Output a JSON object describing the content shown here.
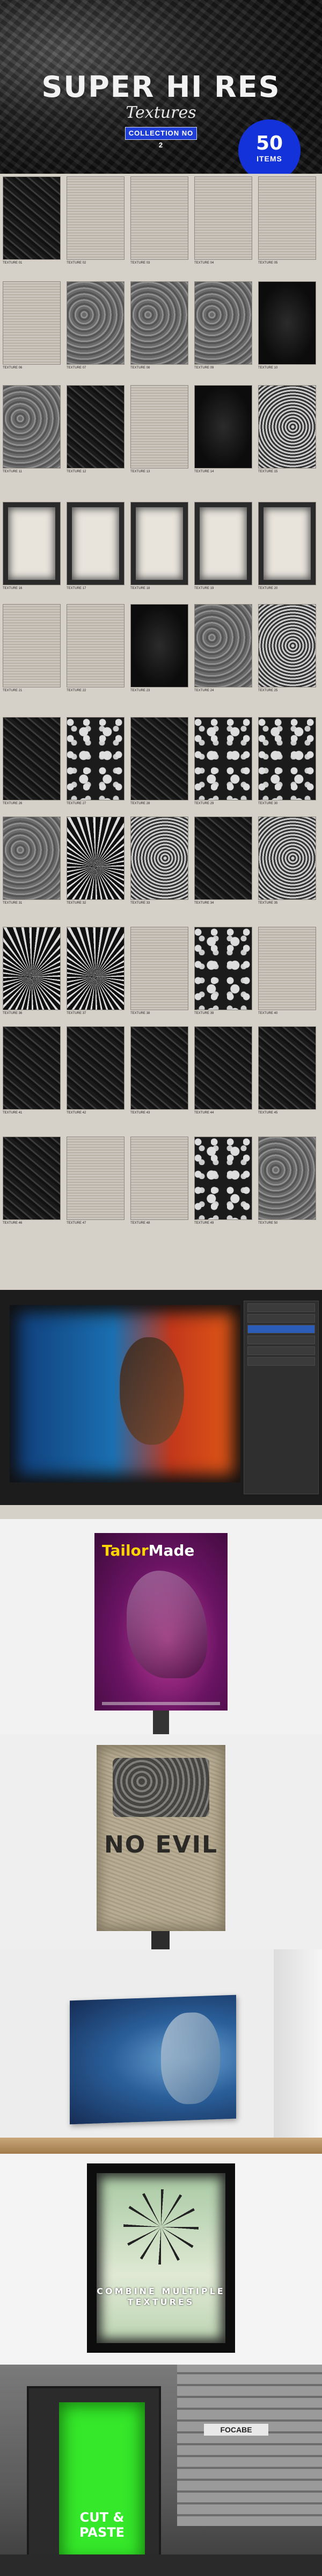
{
  "hero": {
    "title": "SUPER HI RES",
    "subtitle": "Textures",
    "collection": "COLLECTION NO 2",
    "badge_number": "50",
    "badge_label": "ITEMS"
  },
  "grid": {
    "rows": [
      [
        "TEXTURE 01",
        "TEXTURE 02",
        "TEXTURE 03",
        "TEXTURE 04",
        "TEXTURE 05"
      ],
      [
        "TEXTURE 06",
        "TEXTURE 07",
        "TEXTURE 08",
        "TEXTURE 09",
        "TEXTURE 10"
      ],
      [
        "TEXTURE 11",
        "TEXTURE 12",
        "TEXTURE 13",
        "TEXTURE 14",
        "TEXTURE 15"
      ],
      [
        "TEXTURE 16",
        "TEXTURE 17",
        "TEXTURE 18",
        "TEXTURE 19",
        "TEXTURE 20"
      ],
      [
        "TEXTURE 21",
        "TEXTURE 22",
        "TEXTURE 23",
        "TEXTURE 24",
        "TEXTURE 25"
      ],
      [
        "TEXTURE 26",
        "TEXTURE 27",
        "TEXTURE 28",
        "TEXTURE 29",
        "TEXTURE 30"
      ],
      [
        "TEXTURE 31",
        "TEXTURE 32",
        "TEXTURE 33",
        "TEXTURE 34",
        "TEXTURE 35"
      ],
      [
        "TEXTURE 36",
        "TEXTURE 37",
        "TEXTURE 38",
        "TEXTURE 39",
        "TEXTURE 40"
      ],
      [
        "TEXTURE 41",
        "TEXTURE 42",
        "TEXTURE 43",
        "TEXTURE 44",
        "TEXTURE 45"
      ],
      [
        "TEXTURE 46",
        "TEXTURE 47",
        "TEXTURE 48",
        "TEXTURE 49",
        "TEXTURE 50"
      ]
    ]
  },
  "showcase": {
    "tailor_brand_a": "Tailor",
    "tailor_brand_b": "Made",
    "no_evil": "NO EVIL",
    "combine_text": "COMBINE MULTIPLE TEXTURES",
    "cut_paste": "CUT & PASTE",
    "street_sign": "FOCABE"
  },
  "colors": {
    "accent_blue": "#1432d9",
    "grid_bg": "#d6d1c8"
  }
}
